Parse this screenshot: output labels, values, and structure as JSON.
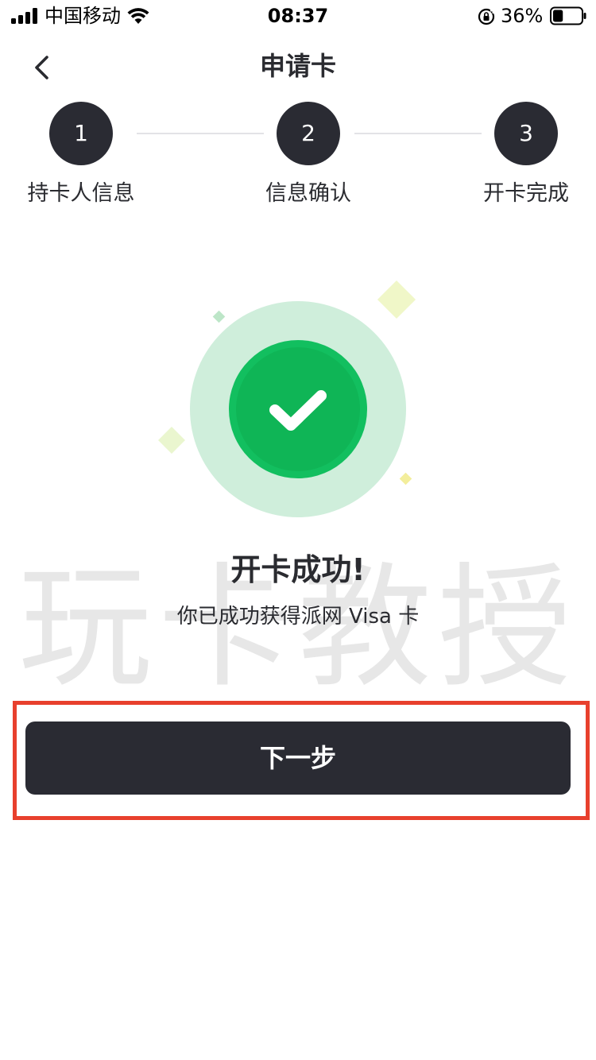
{
  "status_bar": {
    "carrier": "中国移动",
    "time": "08:37",
    "battery_percent": "36%",
    "battery_level": 0.36,
    "icons": [
      "signal-icon",
      "wifi-icon",
      "rotation-lock-icon",
      "battery-icon"
    ]
  },
  "nav": {
    "title": "申请卡",
    "back_icon": "chevron-left-icon"
  },
  "stepper": {
    "steps": [
      {
        "number": "1",
        "label": "持卡人信息"
      },
      {
        "number": "2",
        "label": "信息确认"
      },
      {
        "number": "3",
        "label": "开卡完成"
      }
    ]
  },
  "success": {
    "icon": "checkmark-icon",
    "title": "开卡成功!",
    "subtitle": "你已成功获得派网 Visa 卡"
  },
  "watermark": "玩卡教授",
  "actions": {
    "next_label": "下一步"
  },
  "colors": {
    "primary_dark": "#2a2b33",
    "success_green": "#12bf5f",
    "success_halo": "#cfeedb",
    "highlight_red": "#e8402d"
  }
}
